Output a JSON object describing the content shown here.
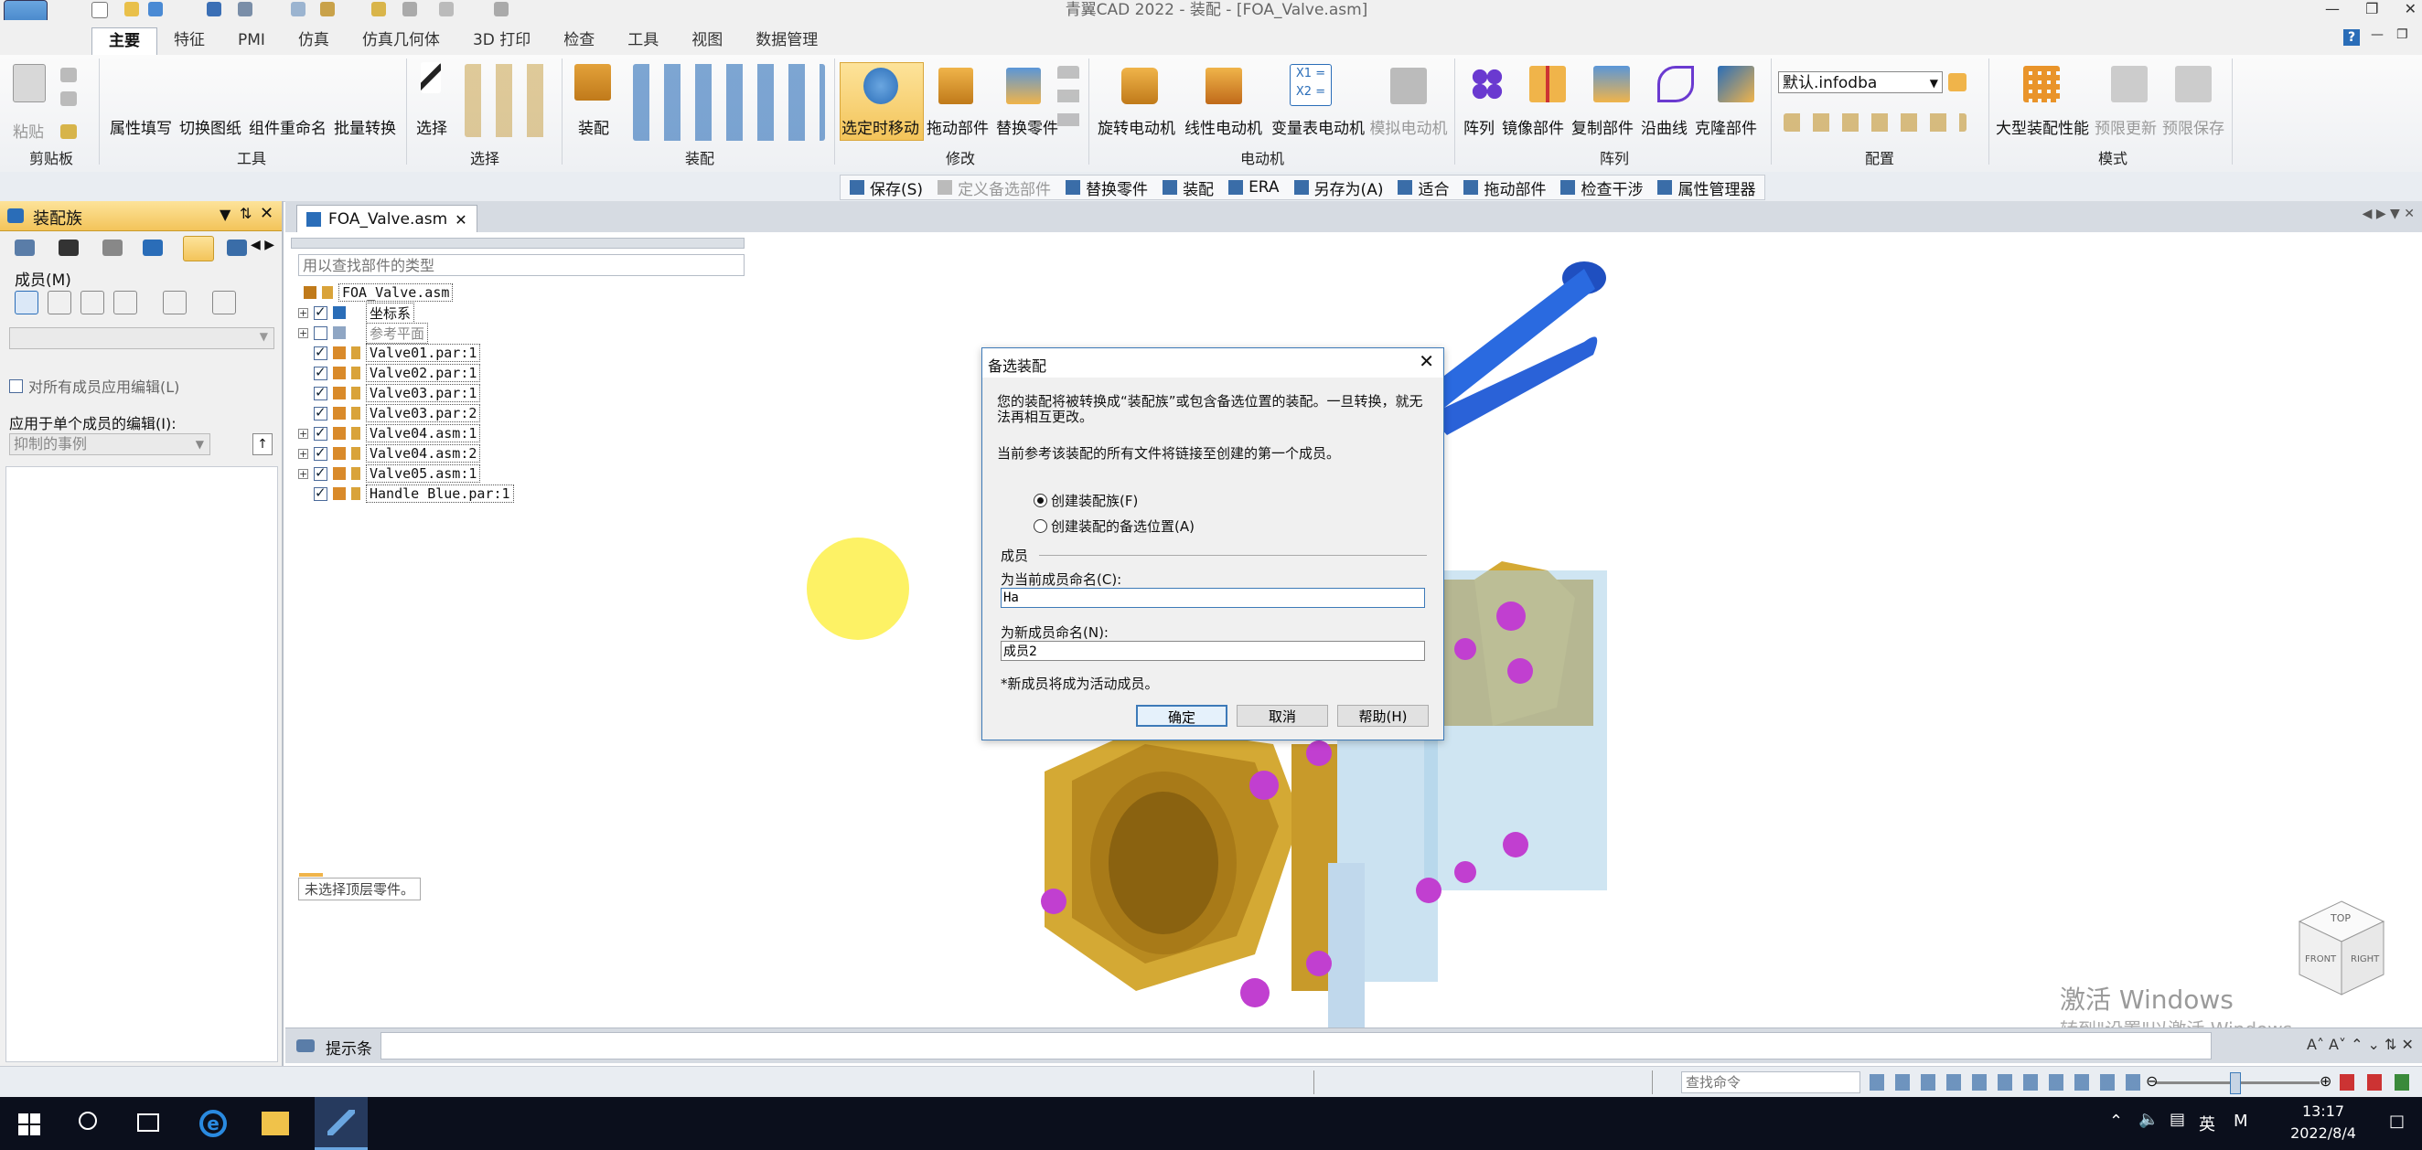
{
  "window": {
    "title": "青翼CAD 2022 - 装配 - [FOA_Valve.asm]",
    "help": "?"
  },
  "menu_tabs": [
    "主要",
    "特征",
    "PMI",
    "仿真",
    "仿真几何体",
    "3D 打印",
    "检查",
    "工具",
    "视图",
    "数据管理"
  ],
  "ribbon": {
    "clipboard": {
      "paste": "粘贴",
      "group": "剪贴板"
    },
    "tools": {
      "buttons": [
        "属性填写",
        "切换图纸",
        "组件重命名",
        "批量转换"
      ],
      "group": "工具"
    },
    "select": {
      "button": "选择",
      "group": "选择"
    },
    "assembly": {
      "button": "装配",
      "group": "装配"
    },
    "modify": {
      "buttons": [
        "选定时移动",
        "拖动部件",
        "替换零件"
      ],
      "group": "修改"
    },
    "motor": {
      "buttons": [
        "旋转电动机",
        "线性电动机",
        "变量表电动机"
      ],
      "group": "电动机"
    },
    "simulate_motor": "模拟电动机",
    "array": {
      "buttons": [
        "阵列",
        "镜像部件",
        "复制部件",
        "沿曲线",
        "克隆部件"
      ],
      "group": "阵列"
    },
    "config": {
      "dropdown_value": "默认.infodba",
      "group": "配置"
    },
    "mode": {
      "buttons": [
        "大型装配性能",
        "预限更新",
        "预限保存"
      ],
      "group": "模式"
    }
  },
  "quick_toolbar": [
    "保存(S)",
    "定义备选部件",
    "替换零件",
    "装配",
    "ERA",
    "另存为(A)",
    "适合",
    "拖动部件",
    "检查干涉",
    "属性管理器"
  ],
  "left_panel": {
    "title": "装配族",
    "members_label": "成员(M)",
    "apply_all": "对所有成员应用编辑(L)",
    "apply_single": "应用于单个成员的编辑(I):",
    "suppress_value": "抑制的事例"
  },
  "doc_tab": "FOA_Valve.asm",
  "tree": {
    "search_placeholder": "用以查找部件的类型",
    "root": "FOA_Valve.asm",
    "items": [
      "坐标系",
      "参考平面",
      "Valve01.par:1",
      "Valve02.par:1",
      "Valve03.par:1",
      "Valve03.par:2",
      "Valve04.asm:1",
      "Valve04.asm:2",
      "Valve05.asm:1",
      "Handle Blue.par:1"
    ],
    "status": "未选择顶层零件。"
  },
  "dialog": {
    "title": "备选装配",
    "text1": "您的装配将被转换成“装配族”或包含备选位置的装配。一旦转换，就无法再相互更改。",
    "text2": "当前参考该装配的所有文件将链接至创建的第一个成员。",
    "radio1": "创建装配族(F)",
    "radio2": "创建装配的备选位置(A)",
    "section": "成员",
    "current_label": "为当前成员命名(C):",
    "current_value": "Ha",
    "new_label": "为新成员命名(N):",
    "new_value": "成员2",
    "note": "*新成员将成为活动成员。",
    "ok": "确定",
    "cancel": "取消",
    "help": "帮助(H)"
  },
  "cube": {
    "top": "TOP",
    "front": "FRONT",
    "right": "RIGHT"
  },
  "prompt_bar": "提示条",
  "watermark": {
    "line1": "激活 Windows",
    "line2": "转到\"设置\"以激活 Windows。"
  },
  "status_bar": {
    "search_placeholder": "查找命令"
  },
  "taskbar": {
    "time": "13:17",
    "date": "2022/8/4",
    "ime": "英",
    "ime2": "M"
  },
  "colors": {
    "accent": "#f0c24a",
    "dialog_border": "#3d7ab8",
    "valve_brass": "#c89a2a",
    "bolt": "#c13fd0",
    "handle": "#1f5ed8"
  }
}
